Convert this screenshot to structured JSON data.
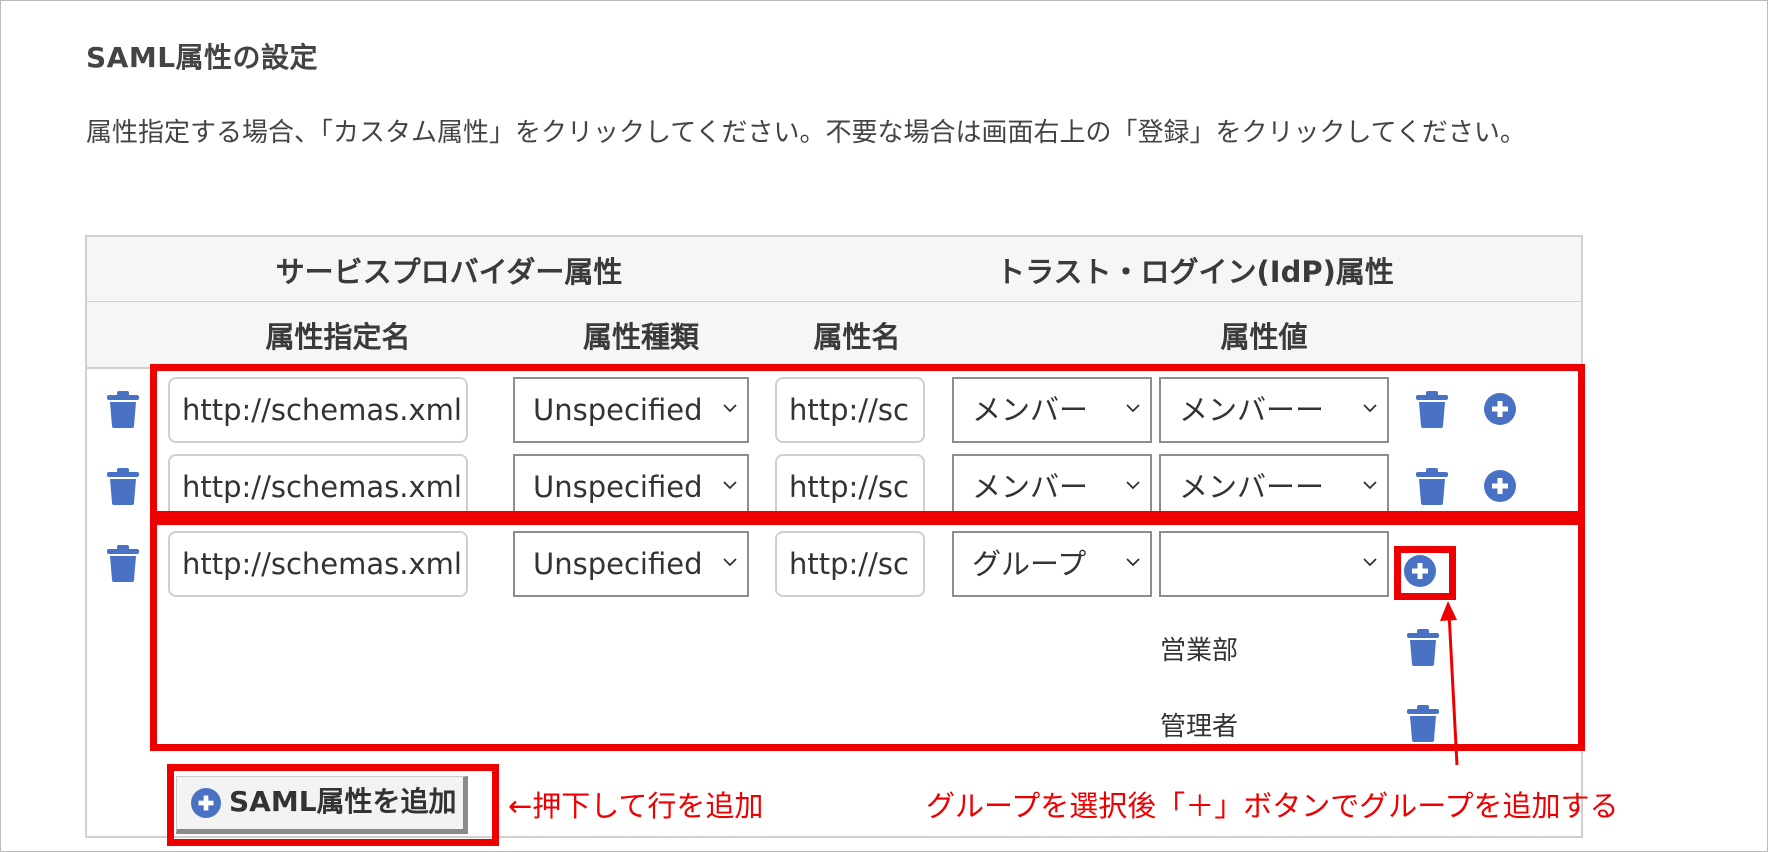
{
  "section_title": "SAML属性の設定",
  "description": "属性指定する場合、「カスタム属性」をクリックしてください。不要な場合は画面右上の「登録」をクリックしてください。",
  "table": {
    "group_headers": {
      "sp": "サービスプロバイダー属性",
      "idp": "トラスト・ログイン(IdP)属性"
    },
    "column_headers": {
      "attr_spec_name": "属性指定名",
      "attr_type": "属性種類",
      "attr_name": "属性名",
      "attr_value": "属性値"
    },
    "rows": [
      {
        "spec_name": "http://schemas.xml",
        "type": "Unspecified",
        "name": "http://sc",
        "source": "メンバー",
        "value": "メンバーー"
      },
      {
        "spec_name": "http://schemas.xml",
        "type": "Unspecified",
        "name": "http://sc",
        "source": "メンバー",
        "value": "メンバーー"
      },
      {
        "spec_name": "http://schemas.xml",
        "type": "Unspecified",
        "name": "http://sc",
        "source": "グループ",
        "value": ""
      }
    ],
    "groups": [
      "営業部",
      "管理者"
    ]
  },
  "add_button_label": "SAML属性を追加",
  "annotations": {
    "add_row": "←押下して行を追加",
    "add_group": "グループを選択後「＋」ボタンでグループを追加する"
  },
  "colors": {
    "icon_blue": "#4a72c4",
    "highlight_red": "#ee0000"
  },
  "icons": {
    "delete": "trash-icon",
    "add": "plus-circle-icon",
    "dropdown": "chevron-down-icon"
  }
}
